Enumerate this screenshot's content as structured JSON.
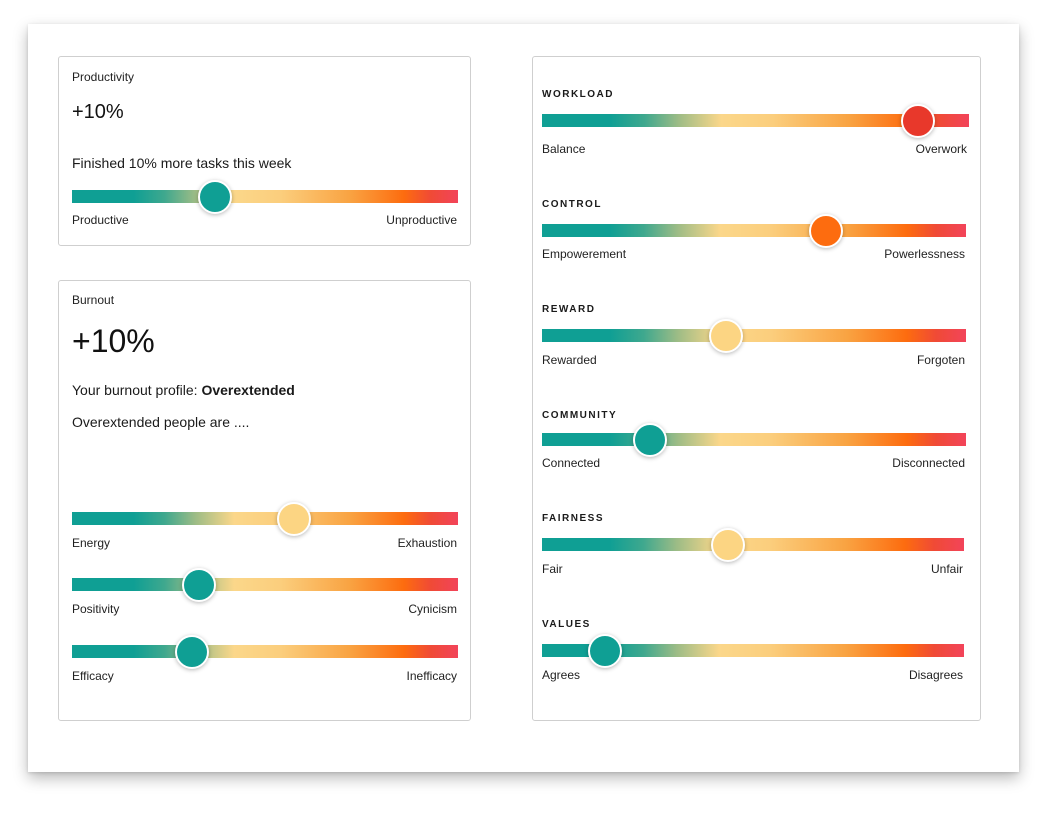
{
  "colors": {
    "teal": "#0f9f94",
    "yellow": "#fcd583",
    "orange": "#fd6c0f",
    "red": "#e8382b",
    "pink_end": "#f2445a"
  },
  "productivity": {
    "title": "Productivity",
    "value": "+10%",
    "description": "Finished 10% more tasks this week",
    "slider": {
      "left": "Productive",
      "right": "Unproductive",
      "level": 0.37,
      "thumb_color": "#0f9f94"
    }
  },
  "burnout": {
    "title": "Burnout",
    "value": "+10%",
    "profile_prefix": "Your burnout profile: ",
    "profile_name": "Overextended",
    "profile_desc": "Overextended people are ....",
    "sliders": [
      {
        "left": "Energy",
        "right": "Exhaustion",
        "level": 0.575,
        "thumb_color": "#fcd583"
      },
      {
        "left": "Positivity",
        "right": "Cynicism",
        "level": 0.33,
        "thumb_color": "#0f9f94"
      },
      {
        "left": "Efficacy",
        "right": "Inefficacy",
        "level": 0.31,
        "thumb_color": "#0f9f94"
      }
    ]
  },
  "categories": [
    {
      "title": "WORKLOAD",
      "left": "Balance",
      "right": "Overwork",
      "level": 0.88,
      "thumb_color": "#e8382b"
    },
    {
      "title": "CONTROL",
      "left": "Empowerement",
      "right": "Powerlessness",
      "level": 0.67,
      "thumb_color": "#fd6c0f"
    },
    {
      "title": "REWARD",
      "left": "Rewarded",
      "right": "Forgoten",
      "level": 0.435,
      "thumb_color": "#fcd583"
    },
    {
      "title": "COMMUNITY",
      "left": "Connected",
      "right": "Disconnected",
      "level": 0.255,
      "thumb_color": "#0f9f94"
    },
    {
      "title": "FAIRNESS",
      "left": "Fair",
      "right": "Unfair",
      "level": 0.44,
      "thumb_color": "#fcd583"
    },
    {
      "title": "VALUES",
      "left": "Agrees",
      "right": "Disagrees",
      "level": 0.15,
      "thumb_color": "#0f9f94"
    }
  ]
}
